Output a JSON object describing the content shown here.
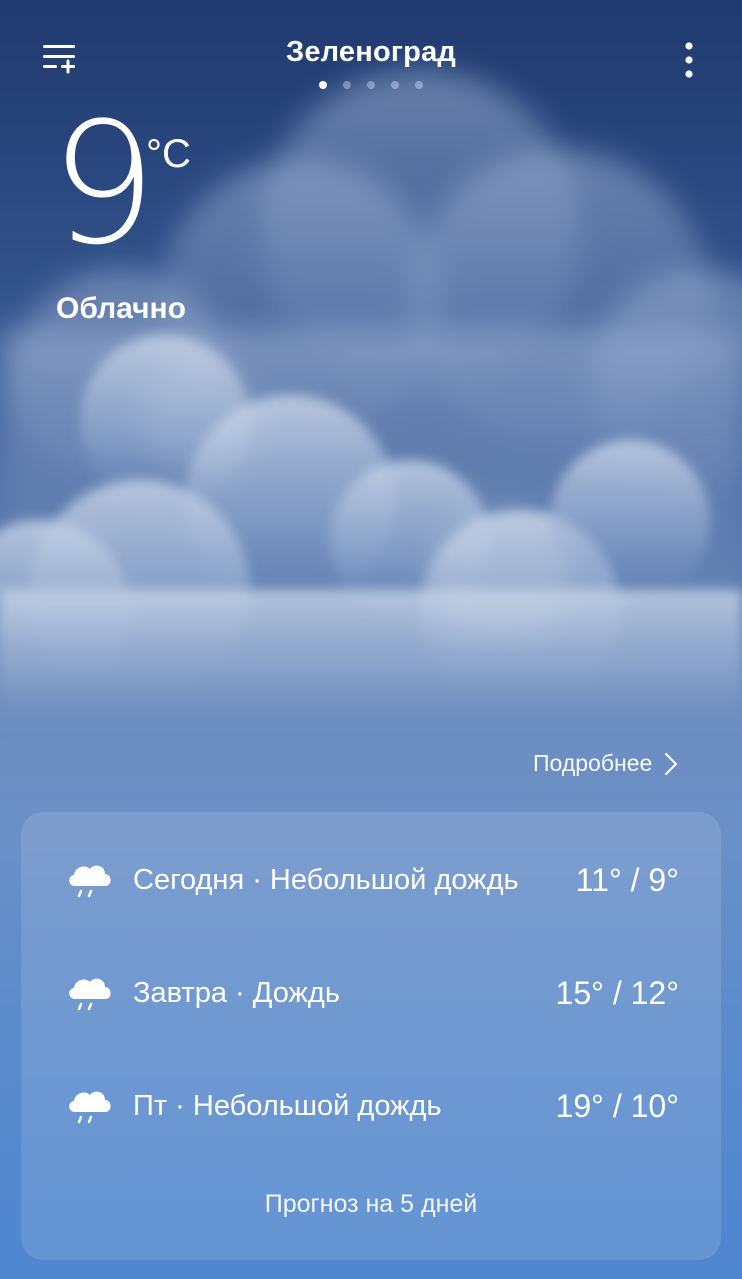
{
  "header": {
    "city": "Зеленоград",
    "page_count": 5,
    "active_page_index": 0
  },
  "current": {
    "temperature": "9",
    "unit": "°C",
    "condition": "Облачно"
  },
  "details_link": {
    "label": "Подробнее"
  },
  "forecast": {
    "days": [
      {
        "day_label": "Сегодня · Небольшой дождь",
        "temps": "11° / 9°",
        "icon": "rain-cloud-icon"
      },
      {
        "day_label": "Завтра · Дождь",
        "temps": "15° / 12°",
        "icon": "rain-cloud-icon"
      },
      {
        "day_label": "Пт · Небольшой дождь",
        "temps": "19° / 10°",
        "icon": "rain-cloud-icon"
      }
    ],
    "five_day_label": "Прогноз на 5 дней"
  },
  "colors": {
    "sky_top": "#1f3a6e",
    "sky_bottom": "#4e86cf",
    "text": "#ffffff"
  }
}
